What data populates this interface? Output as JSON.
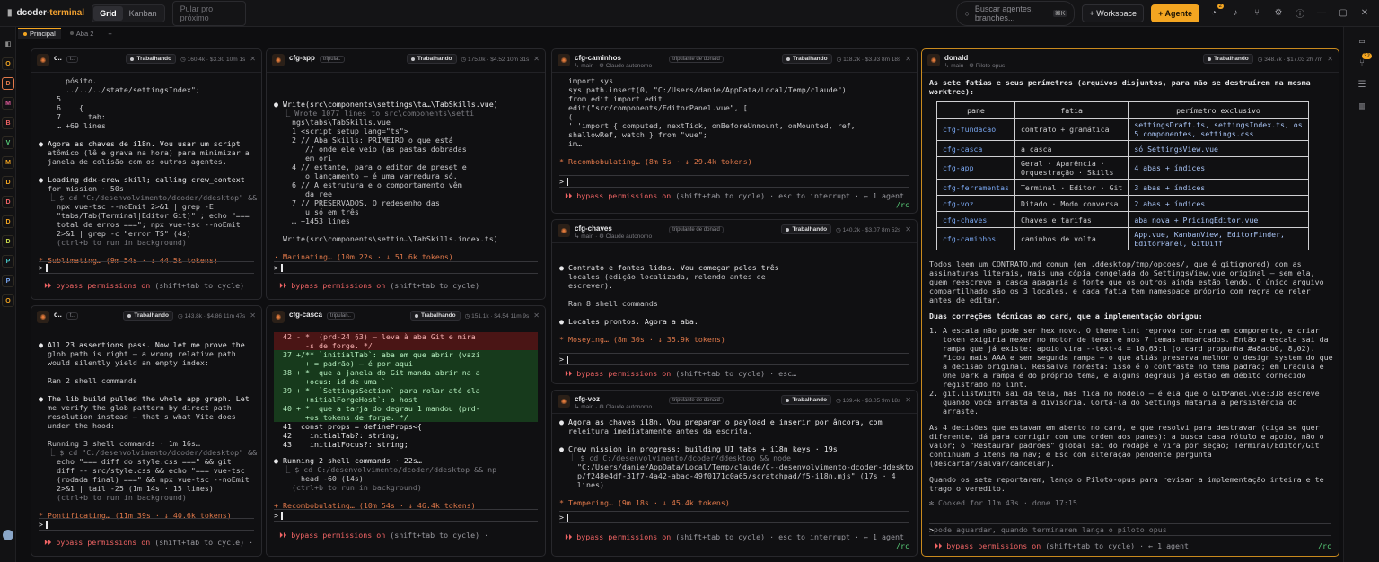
{
  "topbar": {
    "brand_prefix": "dcoder-",
    "brand_suffix": "terminal",
    "views": [
      "Grid",
      "Kanban"
    ],
    "jump_placeholder": "Pular pro próximo",
    "search_placeholder": "Buscar agentes, branches...",
    "search_kbd": "⌘K",
    "workspace_button": "+ Workspace",
    "agent_button": "+ Agente",
    "notifications_count": "2"
  },
  "tabs": [
    {
      "label": "Principal"
    },
    {
      "label": "Aba 2"
    }
  ],
  "left_rail": [
    "O",
    "D",
    "M",
    "B",
    "V",
    "M",
    "D",
    "D",
    "D",
    "D",
    "P",
    "P",
    "O"
  ],
  "right_rail": {
    "badge": "32"
  },
  "panes": {
    "p1": {
      "name": "c..",
      "sub": "t..",
      "status": "Trabalhando",
      "meta": "◷ 160.4k · $3.30  10m 1s",
      "lines": [
        "      pósito.",
        "      ../../../state/settingsIndex\";",
        "    5",
        "    6    {",
        "    7      tab:",
        "    … +69 lines",
        "",
        "● Agora as chaves de i18n. Vou usar um script",
        "  atômico (lê e grava na hora) para minimizar a",
        "  janela de colisão com os outros agentes.",
        "",
        "● Loading ddx-crew skill; calling crew_context",
        "  for mission · 50s",
        "  ⎿ $ cd \"C:/desenvolvimento/dcoder/ddesktop\" &&",
        "    npx vue-tsc --noEmit 2>&1 | grep -E",
        "    \"tabs/Tab(Terminal|Editor|Git)\" ; echo \"===",
        "    total de erros ===\"; npx vue-tsc --noEmit",
        "    2>&1 | grep -c \"error TS\" (4s)",
        "    (ctrl+b to run in background)",
        "",
        "* Sublimating… (9m 54s · ↓ 44.5k tokens)"
      ],
      "bypass": "bypass permissions on",
      "bypass_hint": " (shift+tab to cycle)"
    },
    "p2": {
      "name": "cfg-app",
      "sub": "tripula..",
      "status": "Trabalhando",
      "meta": "◷ 175.0k · $4.52  10m 31s",
      "lines": [
        "● Write(src\\components\\settings\\ta…\\TabSkills.vue)",
        "  ⎿ Wrote 1077 lines to src\\components\\setti",
        "    ngs\\tabs\\TabSkills.vue",
        "    1 <script setup lang=\"ts\">",
        "    2 // Aba Skills: PRIMEIRO o que está",
        "       // onde ele veio (as pastas dobradas",
        "       em ori",
        "    4 // estante, para o editor de preset e",
        "       o lançamento — é uma varredura só.",
        "    6 // A estrutura e o comportamento vêm",
        "       da ree",
        "    7 // PRESERVADOS. O redesenho das",
        "       u só em três",
        "    … +1453 lines",
        "",
        "  Write(src\\components\\settin…\\TabSkills.index.ts)",
        "",
        "· Marinating… (10m 22s · ↓ 51.6k tokens)"
      ],
      "bypass": "bypass permissions on",
      "bypass_hint": " (shift+tab to cycle)"
    },
    "p3": {
      "name": "cfg-caminhos",
      "sub": "↳ main · ⚙ Claude autonomo",
      "tag": "tripulante de donald",
      "status": "Trabalhando",
      "meta": "◷ 118.2k · $3.93  8m 18s",
      "lines": [
        "  import sys",
        "  sys.path.insert(0, \"C:/Users/danie/AppData/Local/Temp/claude\")",
        "  from edit import edit",
        "  edit(\"src/components/EditorPanel.vue\", [",
        "  (",
        "  '''import { computed, nextTick, onBeforeUnmount, onMounted, ref,",
        "  shallowRef, watch } from \"vue\";",
        "  im…",
        "",
        "* Recombobulating… (8m 5s · ↓ 29.4k tokens)"
      ],
      "bypass": "bypass permissions on",
      "bypass_hint": " (shift+tab to cycle) · esc to interrupt · ← 1 agent",
      "rc": "/rc"
    },
    "p4": {
      "name": "cfg-chaves",
      "sub": "↳ main · ⚙ Claude autonomo",
      "tag": "tripulante de donald",
      "status": "Trabalhando",
      "meta": "◷ 140.2k · $3.07  8m 52s",
      "lines": [
        "● Contrato e fontes lidos. Vou começar pelos três",
        "  locales (edição localizada, relendo antes de",
        "  escrever).",
        "",
        "  Ran 8 shell commands",
        "",
        "● Locales prontos. Agora a aba.",
        "",
        "* Moseying… (8m 30s · ↓ 35.9k tokens)"
      ],
      "bypass": "bypass permissions on",
      "bypass_hint": " (shift+tab to cycle) · esc…"
    },
    "p5": {
      "name": "c..",
      "sub": "t..",
      "status": "Trabalhando",
      "meta": "◷ 143.8k · $4.86  11m 47s",
      "lines": [
        "● All 23 assertions pass. Now let me prove the",
        "  glob path is right — a wrong relative path",
        "  would silently yield an empty index:",
        "",
        "  Ran 2 shell commands",
        "",
        "● The lib build pulled the whole app graph. Let",
        "  me verify the glob pattern by direct path",
        "  resolution instead — that's what Vite does",
        "  under the hood:",
        "",
        "  Running 3 shell commands · 1m 16s…",
        "  ⎿ $ cd \"C:/desenvolvimento/dcoder/ddesktop\" &&",
        "    echo \"=== diff do style.css ===\" && git",
        "    diff -- src/style.css && echo \"=== vue-tsc",
        "    (rodada final) ===\" && npx vue-tsc --noEmit",
        "    2>&1 | tail -25 (1m 14s · 15 lines)",
        "    (ctrl+b to run in background)",
        "",
        "* Pontificating… (11m 39s · ↓ 40.6k tokens)"
      ],
      "bypass": "bypass permissions on",
      "bypass_hint": " (shift+tab to cycle) ·"
    },
    "p6": {
      "name": "cfg-casca",
      "sub": "tripulan..",
      "status": "Trabalhando",
      "meta": "◷ 151.1k · $4.54  11m 9s",
      "diff": [
        {
          "k": "del",
          "t": "  42 - *  (prd-24 §3) — leva à aba Git e mira"
        },
        {
          "k": "del",
          "t": "       -s de forge. */"
        },
        {
          "k": "add",
          "t": "  37 +/** `initialTab`: aba em que abrir (vazi"
        },
        {
          "k": "add",
          "t": "       + = padrão) — é por aqui"
        },
        {
          "k": "add",
          "t": "  38 + *  que a janela do Git manda abrir na a"
        },
        {
          "k": "add",
          "t": "       +ocus: id de uma `"
        },
        {
          "k": "add",
          "t": "  39 + *  `SettingsSection` para rolar até ela"
        },
        {
          "k": "add",
          "t": "       +nitialForgeHost`: o host"
        },
        {
          "k": "add",
          "t": "  40 + *  que a tarja do degrau 1 mandou (prd-"
        },
        {
          "k": "add",
          "t": "       +os tokens de forge. */"
        },
        {
          "k": "ctx",
          "t": "  41  const props = defineProps<{"
        },
        {
          "k": "ctx",
          "t": "  42    initialTab?: string;"
        },
        {
          "k": "ctx",
          "t": "  43    initialFocus?: string;"
        }
      ],
      "lines": [
        "● Running 2 shell commands · 22s…",
        "  ⎿ $ cd C:/desenvolvimento/dcoder/ddesktop && np",
        "    | head -60 (14s)",
        "    (ctrl+b to run in background)",
        "",
        "+ Recombobulating… (10m 54s · ↓ 46.4k tokens)"
      ],
      "bypass": "bypass permissions on",
      "bypass_hint": " (shift+tab to cycle) ·"
    },
    "p7": {
      "name": "cfg-voz",
      "sub": "↳ main · ⚙ Claude autonomo",
      "tag": "tripulante de donald",
      "status": "Trabalhando",
      "meta": "◷ 139.4k · $3.05  9m 18s",
      "lines": [
        "● Agora as chaves i18n. Vou preparar o payload e inserir por âncora, com",
        "  releitura imediatamente antes da escrita.",
        "",
        "● Crew mission in progress: building UI tabs + i18n keys · 19s",
        "  ⎿ $ cd C:/desenvolvimento/dcoder/ddesktop && node",
        "    \"C:/Users/danie/AppData/Local/Temp/claude/C--desenvolvimento-dcoder-ddeskto",
        "    p/f248e4df-31f7-4a42-abac-49f0171c0a65/scratchpad/f5-i18n.mjs\" (17s · 4",
        "    lines)",
        "",
        "* Tempering… (9m 18s · ↓ 45.4k tokens)"
      ],
      "bypass": "bypass permissions on",
      "bypass_hint": " (shift+tab to cycle) · esc to interrupt · ← 1 agent",
      "rc": "/rc"
    },
    "p8": {
      "name": "donald",
      "sub": "↳ main · ⚙ Piloto-opus",
      "status": "Trabalhando",
      "meta": "◷ 348.7k · $17.03  2h 7m",
      "intro": "As sete fatias e seus perímetros (arquivos disjuntos, para não se destruírem na mesma\nworktree):",
      "table_head": [
        "pane",
        "fatia",
        "perímetro exclusivo"
      ],
      "table_rows": [
        [
          "cfg-fundacao",
          "contrato + gramática",
          "settingsDraft.ts, settingsIndex.ts, os\n5 componentes, settings.css"
        ],
        [
          "cfg-casca",
          "a casca",
          "só SettingsView.vue"
        ],
        [
          "cfg-app",
          "Geral · Aparência ·\nOrquestração · Skills",
          "4 abas + índices"
        ],
        [
          "cfg-ferramentas",
          "Terminal · Editor · Git",
          "3 abas + índices"
        ],
        [
          "cfg-voz",
          "Ditado · Modo conversa",
          "2 abas + índices"
        ],
        [
          "cfg-chaves",
          "Chaves e tarifas",
          "aba nova + PricingEditor.vue"
        ],
        [
          "cfg-caminhos",
          "caminhos de volta",
          "App.vue, KanbanView, EditorFinder,\nEditorPanel, GitDiff"
        ]
      ],
      "para1": "Todos leem um CONTRATO.md comum (em .ddesktop/tmp/opcoes/, que é gitignored) com as\nassinaturas literais, mais uma cópia congelada do SettingsView.vue original — sem ela,\nquem reescreve a casca apagaria a fonte que os outros ainda estão lendo. O único arquivo\ncompartilhado são os 3 locales, e cada fatia tem namespace próprio com regra de reler\nantes de editar.",
      "para2_title": "Duas correções técnicas ao card, que a implementação obrigou:",
      "para2": "1. A escala não pode ser hex novo. O theme:lint reprova cor crua em componente, e criar\n   token exigiria mexer no motor de temas e nos 7 temas embarcados. Então a escala sai da\n   rampa que já existe: apoio vira --text-4 = 10,65:1 (o card propunha #a8adb0, 8,02).\n   Ficou mais AAA e sem segunda rampa — o que aliás preserva melhor o design system do que\n   a decisão original. Ressalva honesta: isso é o contraste no tema padrão; em Dracula e\n   One Dark a rampa é do próprio tema, e alguns degraus já estão em débito conhecido\n   registrado no lint.\n2. git.listWidth sai da tela, mas fica no modelo — é ela que o GitPanel.vue:318 escreve\n   quando você arrasta a divisória. Cortá-la do Settings mataria a persistência do\n   arraste.",
      "para3": "As 4 decisões que estavam em aberto no card, e que resolvi para destravar (diga se quer\ndiferente, dá para corrigir com uma ordem aos panes): a busca casa rótulo e apoio, não o\nvalor; o \"Restaurar padrões\" global sai do rodapé e vira por seção; Terminal/Editor/Git\ncontinuam 3 itens na nav; e Esc com alteração pendente pergunta\n(descartar/salvar/cancelar).",
      "para4": "Quando os sete reportarem, lanço o Piloto-opus para revisar a implementação inteira e te\ntrago o veredito.",
      "cooked": "✻ Cooked for 11m 43s · done 17:15",
      "input_placeholder": "pode aguardar, quando terminarem lança o piloto opus",
      "bypass": "bypass permissions on",
      "bypass_hint": " (shift+tab to cycle) · ← 1 agent",
      "rc": "/rc"
    }
  }
}
